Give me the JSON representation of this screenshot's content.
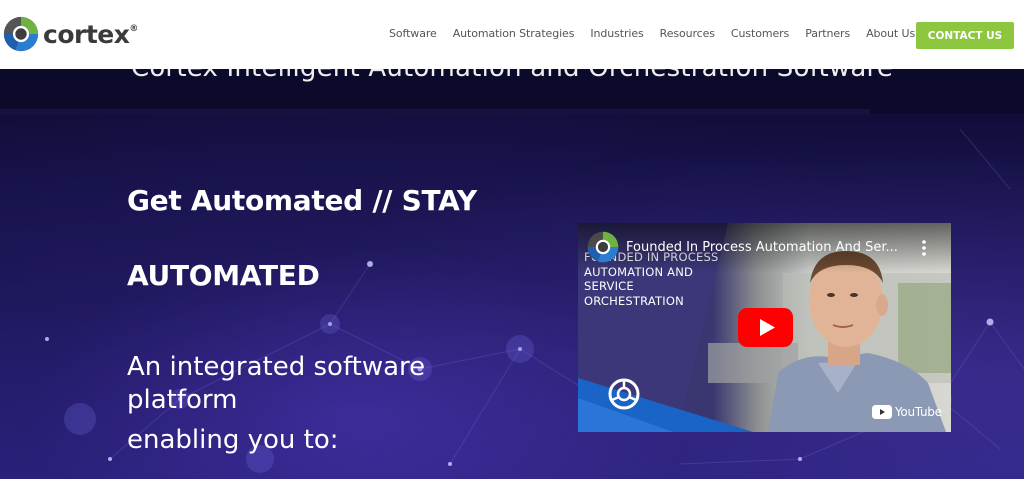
{
  "brand": {
    "name": "cortex",
    "trademark": "®",
    "logo_icon": "cortex-logo-icon"
  },
  "nav": {
    "items": [
      {
        "label": "Software"
      },
      {
        "label": "Automation Strategies"
      },
      {
        "label": "Industries"
      },
      {
        "label": "Resources"
      },
      {
        "label": "Customers"
      },
      {
        "label": "Partners"
      },
      {
        "label": "About Us"
      }
    ],
    "cta_label": "CONTACT US"
  },
  "hero": {
    "cut_title": "Cortex Intelligent Automation and Orchestration Software",
    "headline_line1": "Get Automated // STAY",
    "headline_line2": "AUTOMATED",
    "subheading_line1": "An integrated software platform",
    "subheading_line2": "enabling you to:"
  },
  "video": {
    "title": "Founded In Process Automation And Ser...",
    "slide_text": "FOUNDED IN PROCESS\nAUTOMATION AND\nSERVICE\nORCHESTRATION",
    "platform_label": "YouTube",
    "play_icon": "play-icon",
    "menu_icon": "more-vert-icon"
  },
  "colors": {
    "accent": "#8dc63f",
    "hero_bg": "#1b1657",
    "play_red": "#ff0000",
    "logo_blue": "#1a64c8",
    "logo_green": "#6fb23f"
  }
}
